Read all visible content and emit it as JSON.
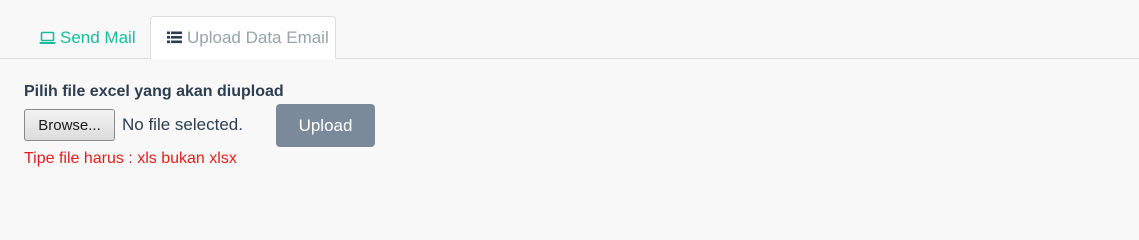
{
  "tabs": {
    "send_mail": {
      "label": "Send Mail",
      "icon": "laptop-icon"
    },
    "upload_data_email": {
      "label": "Upload Data Email",
      "icon": "list-icon"
    }
  },
  "form": {
    "label": "Pilih file excel yang akan diupload",
    "browse_label": "Browse...",
    "file_status": "No file selected.",
    "upload_label": "Upload",
    "hint": "Tipe file harus : xls bukan xlsx"
  },
  "colors": {
    "accent": "#18bc9c",
    "inactive_tab_text": "#95a5a6",
    "upload_button": "#7b8a9b",
    "error_text": "#e31d1d"
  }
}
